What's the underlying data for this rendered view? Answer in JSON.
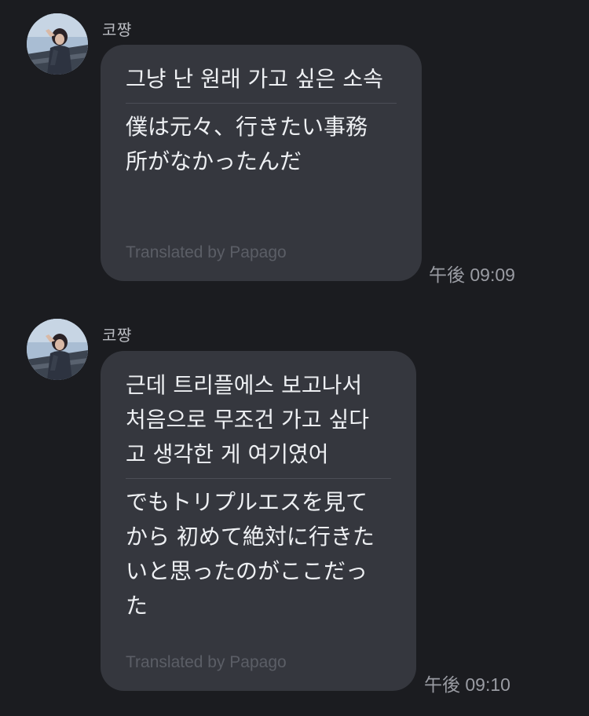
{
  "messages": [
    {
      "sender": "코쨩",
      "avatar_icon": "profile-photo",
      "original": "그냥 난 원래 가고 싶은 소속",
      "translated": "僕は元々、行きたい事務\n所がなかったんだ",
      "attribution": "Translated by Papago",
      "time": "午後 09:09"
    },
    {
      "sender": "코쨩",
      "avatar_icon": "profile-photo",
      "original": "근데 트리플에스 보고나서\n처음으로 무조건 가고 싶다\n고 생각한 게 여기였어",
      "translated": "でもトリプルエスを見て\nから 初めて絶対に行きた\nいと思ったのがここだっ\nた",
      "attribution": "Translated by Papago",
      "time": "午後 09:10"
    }
  ],
  "colors": {
    "background": "#1b1c20",
    "bubble": "#35373e",
    "text": "#eef0f3",
    "muted": "#9a9ca3"
  }
}
